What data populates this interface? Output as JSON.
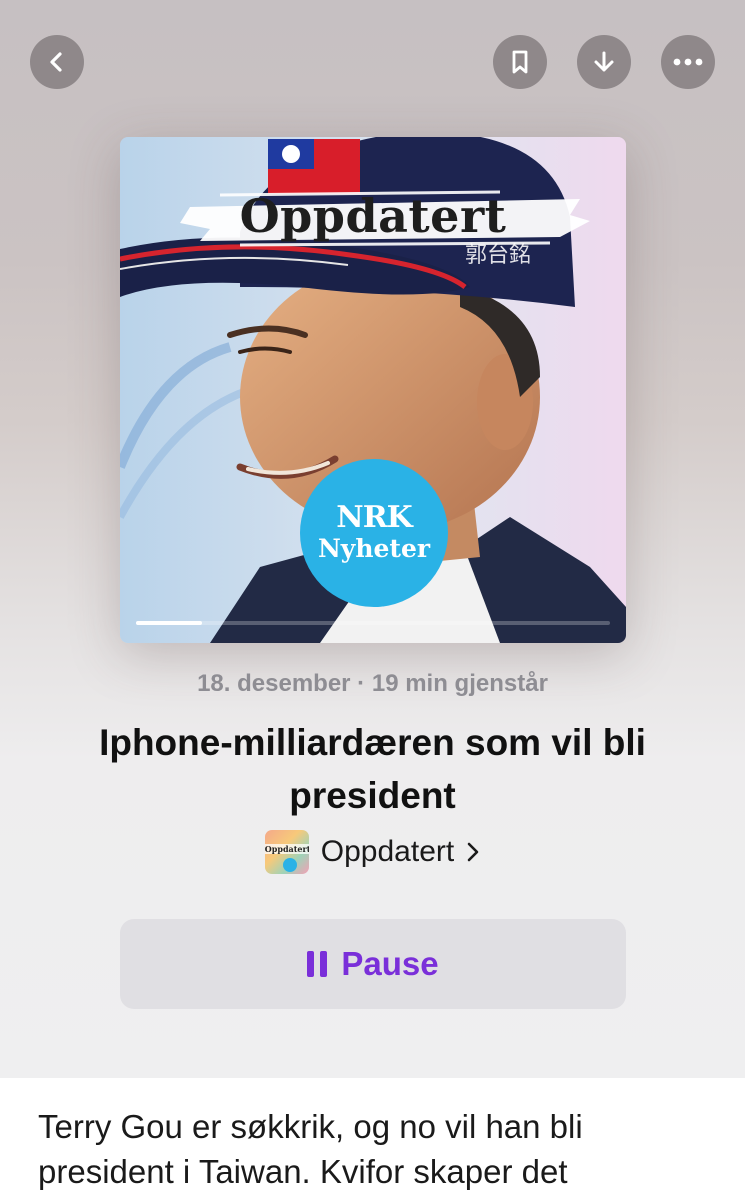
{
  "artwork": {
    "title": "Oppdatert",
    "cap_text": "郭台銘",
    "badge_logo": "NRK",
    "badge_name": "Nyheter"
  },
  "playback_progress": 0.14,
  "episode": {
    "date": "18. desember",
    "separator": "·",
    "remaining": "19 min gjenstår",
    "title": "Iphone-milliardæren som vil bli president"
  },
  "show": {
    "name": "Oppdatert",
    "thumb_text": "Oppdatert"
  },
  "pause_button": {
    "label": "Pause"
  },
  "description": "Terry Gou er søkkrik, og no vil han bli president i Taiwan. Kvifor skaper det",
  "colors": {
    "accent": "#7a2fd9",
    "badge": "#2ab2e6",
    "button_bg": "#e0dfe3",
    "meta_text": "#8e8d93"
  },
  "icons": [
    "chevron-left-icon",
    "bookmark-icon",
    "download-icon",
    "more-icon",
    "chevron-right-icon",
    "pause-icon"
  ]
}
